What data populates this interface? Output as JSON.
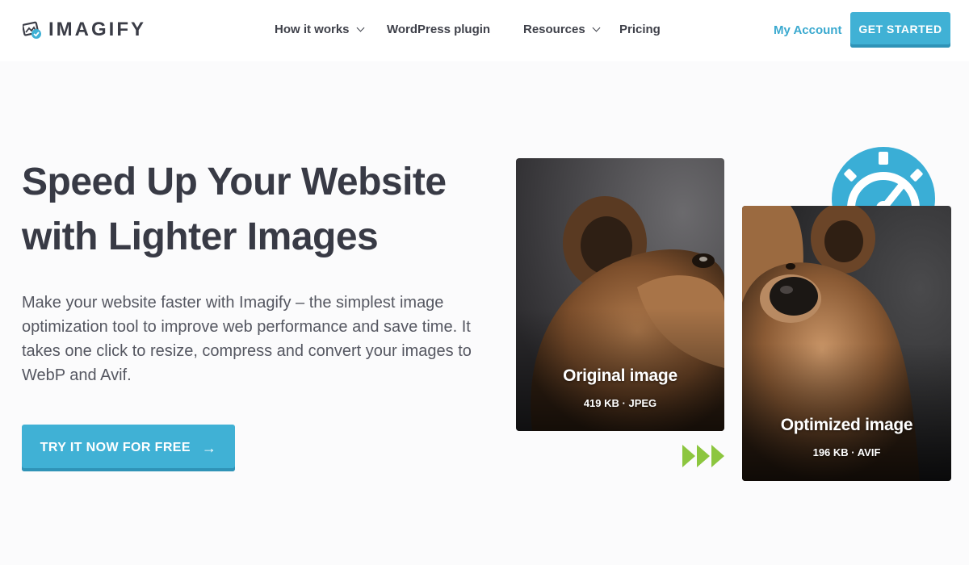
{
  "brand": {
    "name": "IMAGIFY"
  },
  "nav": {
    "items": [
      {
        "label": "How it works",
        "has_dropdown": true
      },
      {
        "label": "WordPress plugin",
        "has_dropdown": false
      },
      {
        "label": "Resources",
        "has_dropdown": true
      },
      {
        "label": "Pricing",
        "has_dropdown": false
      }
    ],
    "my_account": "My Account",
    "get_started": "GET STARTED"
  },
  "hero": {
    "headline_line1": "Speed Up Your Website",
    "headline_line2": "with Lighter Images",
    "description": "Make your website faster with Imagify – the simplest image optimization tool to improve web performance and save time. It takes one click to resize, compress and convert your images to WebP and Avif.",
    "cta_label": "TRY IT NOW FOR FREE",
    "cta_icon": "arrow-right-icon"
  },
  "comparison": {
    "original": {
      "title": "Original image",
      "meta": "419 KB · JPEG"
    },
    "optimized": {
      "title": "Optimized image",
      "meta": "196 KB · AVIF"
    },
    "gauge_icon": "speedometer-icon",
    "transition_icon": "fast-forward-icon"
  },
  "colors": {
    "accent": "#40b1d5",
    "accent_dark": "#2f93b7",
    "link": "#3aa9cf",
    "heading": "#383a45",
    "arrow_green": "#8cc63f"
  }
}
